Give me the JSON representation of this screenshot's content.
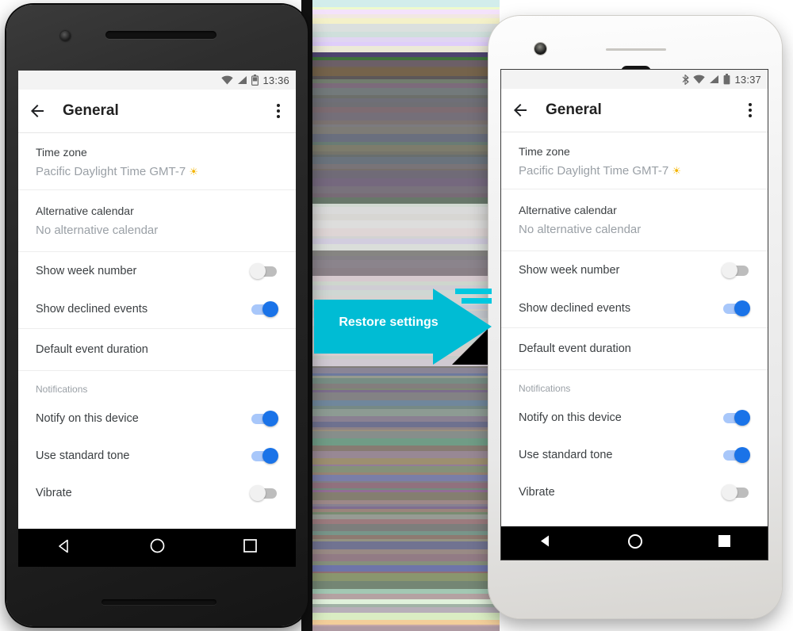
{
  "meta": {
    "accent_blue": "#1a73e8",
    "toggle_off_track": "#bdbdbd",
    "toggle_on_track": "#a8c7fa",
    "cyan_arrow": "#00bcd4",
    "sun_yellow": "#f4b400"
  },
  "callout": {
    "label": "Restore settings",
    "arrow_color": "#00bcd4",
    "text_color": "#ffffff"
  },
  "phone_left": {
    "device_name": "dark-android-phone",
    "status_bar": {
      "time": "13:36",
      "icons": [
        "wifi-icon",
        "signal-icon",
        "battery-icon"
      ]
    },
    "app_bar": {
      "back_icon": "back-arrow-icon",
      "title": "General",
      "overflow_icon": "overflow-menu-icon"
    },
    "sections": [
      {
        "type": "stack",
        "items": [
          {
            "label": "Time zone",
            "value": "Pacific Daylight Time  GMT-7",
            "suffix_icon": "sun-icon"
          }
        ]
      },
      {
        "type": "stack",
        "items": [
          {
            "label": "Alternative calendar",
            "value": "No alternative calendar"
          }
        ]
      },
      {
        "type": "toggles",
        "items": [
          {
            "label": "Show week number",
            "state": "off"
          },
          {
            "label": "Show declined events",
            "state": "on"
          }
        ]
      },
      {
        "type": "rows",
        "items": [
          {
            "label": "Default event duration"
          }
        ]
      },
      {
        "type": "group",
        "heading": "Notifications",
        "items": [
          {
            "label": "Notify on this device",
            "state": "on"
          },
          {
            "label": "Use standard tone",
            "state": "on"
          },
          {
            "label": "Vibrate",
            "state": "off"
          }
        ]
      }
    ],
    "nav_bar": {
      "back": "nav-back-icon",
      "home": "nav-home-icon",
      "recents": "nav-recents-icon"
    }
  },
  "phone_right": {
    "device_name": "white-android-phone",
    "status_bar": {
      "time": "13:37",
      "icons": [
        "bluetooth-icon",
        "wifi-icon",
        "signal-icon",
        "battery-icon"
      ]
    },
    "app_bar": {
      "back_icon": "back-arrow-icon",
      "title": "General",
      "overflow_icon": "overflow-menu-icon"
    },
    "sections": [
      {
        "type": "stack",
        "items": [
          {
            "label": "Time zone",
            "value": "Pacific Daylight Time  GMT-7",
            "suffix_icon": "sun-icon"
          }
        ]
      },
      {
        "type": "stack",
        "items": [
          {
            "label": "Alternative calendar",
            "value": "No alternative calendar"
          }
        ]
      },
      {
        "type": "toggles",
        "items": [
          {
            "label": "Show week number",
            "state": "off"
          },
          {
            "label": "Show declined events",
            "state": "on"
          }
        ]
      },
      {
        "type": "rows",
        "items": [
          {
            "label": "Default event duration"
          }
        ]
      },
      {
        "type": "group",
        "heading": "Notifications",
        "items": [
          {
            "label": "Notify on this device",
            "state": "on"
          },
          {
            "label": "Use standard tone",
            "state": "on"
          },
          {
            "label": "Vibrate",
            "state": "off"
          }
        ]
      }
    ],
    "nav_bar": {
      "back": "nav-back-icon",
      "home": "nav-home-icon",
      "recents": "nav-recents-icon"
    }
  }
}
